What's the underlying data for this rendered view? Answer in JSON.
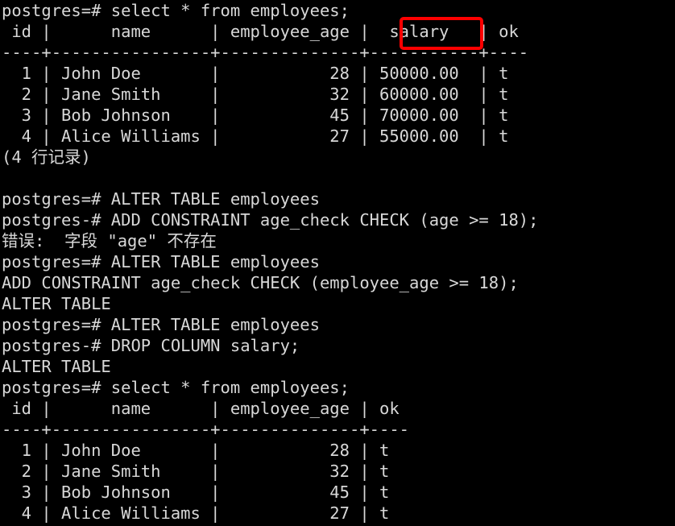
{
  "terminal": {
    "background_color": "#000000",
    "text_color": "#d8d8d8",
    "prompt_ready": "postgres=#",
    "prompt_continuation": "postgres-#",
    "lines": [
      "postgres=# select * from employees;",
      " id |      name      | employee_age |  salary   | ok",
      "----+----------------+--------------+-----------+----",
      "  1 | John Doe       |           28 | 50000.00  | t",
      "  2 | Jane Smith     |           32 | 60000.00  | t",
      "  3 | Bob Johnson    |           45 | 70000.00  | t",
      "  4 | Alice Williams |           27 | 55000.00  | t",
      "(4 行记录)",
      "",
      "postgres=# ALTER TABLE employees",
      "postgres-# ADD CONSTRAINT age_check CHECK (age >= 18);",
      "错误:  字段 \"age\" 不存在",
      "postgres=# ALTER TABLE employees",
      "ADD CONSTRAINT age_check CHECK (employee_age >= 18);",
      "ALTER TABLE",
      "postgres=# ALTER TABLE employees",
      "postgres-# DROP COLUMN salary;",
      "ALTER TABLE",
      "postgres=# select * from employees;",
      " id |      name      | employee_age | ok",
      "----+----------------+--------------+----",
      "  1 | John Doe       |           28 | t",
      "  2 | Jane Smith     |           32 | t",
      "  3 | Bob Johnson    |           45 | t",
      "  4 | Alice Williams |           27 | t"
    ]
  },
  "annotation": {
    "highlight_label": "salary",
    "highlight_color": "#ff0000",
    "highlight_shape": "rectangle-outline"
  },
  "queries": {
    "first_select": "select * from employees;",
    "alter_add_constraint_failed": "ALTER TABLE employees ADD CONSTRAINT age_check CHECK (age >= 18);",
    "error_message": "错误:  字段 \"age\" 不存在",
    "alter_add_constraint_ok": "ALTER TABLE employees ADD CONSTRAINT age_check CHECK (employee_age >= 18);",
    "alter_drop_column": "ALTER TABLE employees DROP COLUMN salary;",
    "result_alter_table": "ALTER TABLE",
    "row_count_message": "(4 行记录)",
    "second_select": "select * from employees;"
  },
  "table_before": {
    "columns": [
      "id",
      "name",
      "employee_age",
      "salary",
      "ok"
    ],
    "rows": [
      [
        "1",
        "John Doe",
        "28",
        "50000.00",
        "t"
      ],
      [
        "2",
        "Jane Smith",
        "32",
        "60000.00",
        "t"
      ],
      [
        "3",
        "Bob Johnson",
        "45",
        "70000.00",
        "t"
      ],
      [
        "4",
        "Alice Williams",
        "27",
        "55000.00",
        "t"
      ]
    ],
    "row_count": "(4 行记录)"
  },
  "table_after": {
    "columns": [
      "id",
      "name",
      "employee_age",
      "ok"
    ],
    "rows": [
      [
        "1",
        "John Doe",
        "28",
        "t"
      ],
      [
        "2",
        "Jane Smith",
        "32",
        "t"
      ],
      [
        "3",
        "Bob Johnson",
        "45",
        "t"
      ],
      [
        "4",
        "Alice Williams",
        "27",
        "t"
      ]
    ]
  }
}
